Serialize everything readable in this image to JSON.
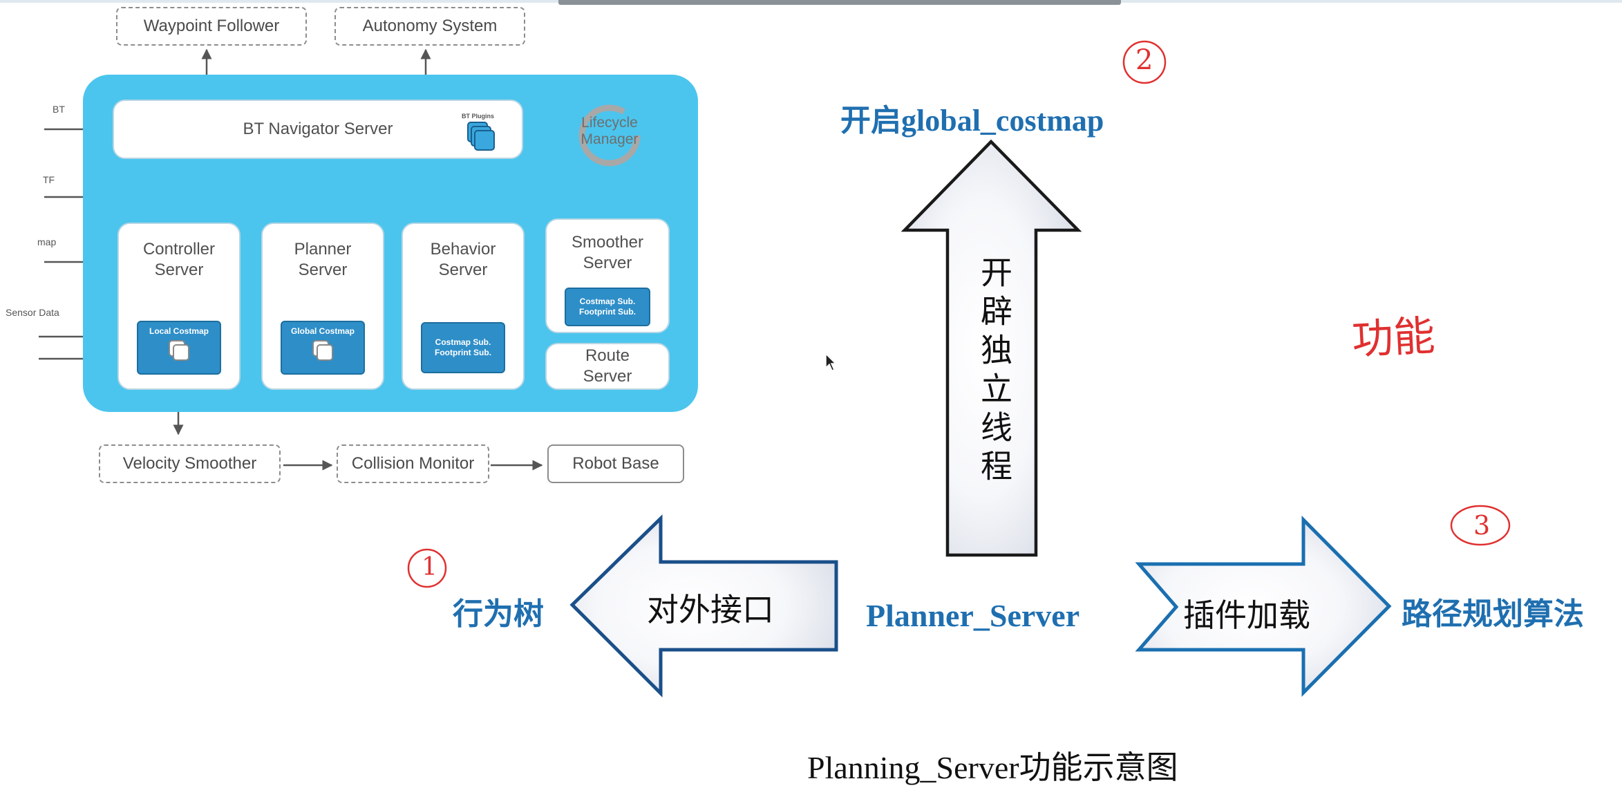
{
  "nav2_diagram": {
    "external_top": [
      "Waypoint Follower",
      "Autonomy System"
    ],
    "bt_navigator": "BT Navigator Server",
    "bt_plugins": "BT Plugins",
    "lifecycle_manager": "Lifecycle\nManager",
    "inputs": [
      "BT",
      "TF",
      "map",
      "Sensor Data"
    ],
    "servers": {
      "controller": "Controller\nServer",
      "planner": "Planner\nServer",
      "behavior": "Behavior\nServer",
      "smoother": "Smoother\nServer",
      "route": "Route\nServer"
    },
    "chips": {
      "local_costmap": "Local Costmap",
      "global_costmap": "Global Costmap",
      "behavior_sub": "Costmap Sub.\nFootprint Sub.",
      "smoother_sub": "Costmap Sub.\nFootprint Sub."
    },
    "external_bottom": [
      "Velocity Smoother",
      "Collision Monitor",
      "Robot Base"
    ]
  },
  "function_diagram": {
    "center_label": "Planner_Server",
    "up_arrow_text": "开辟独立线程",
    "up_target": "开启global_costmap",
    "left_arrow_text": "对外接口",
    "left_target": "行为树",
    "right_arrow_text": "插件加载",
    "right_target": "路径规划算法",
    "caption": "Planning_Server功能示意图"
  },
  "annotations": {
    "circle_1": "1",
    "circle_2": "2",
    "circle_3": "3",
    "handwritten_note": "功能"
  },
  "colors": {
    "panel_blue": "#4bc5ee",
    "arrow_outline": "#1a4f8a",
    "title_blue": "#1f6fb0",
    "annotation_red": "#e03030"
  }
}
